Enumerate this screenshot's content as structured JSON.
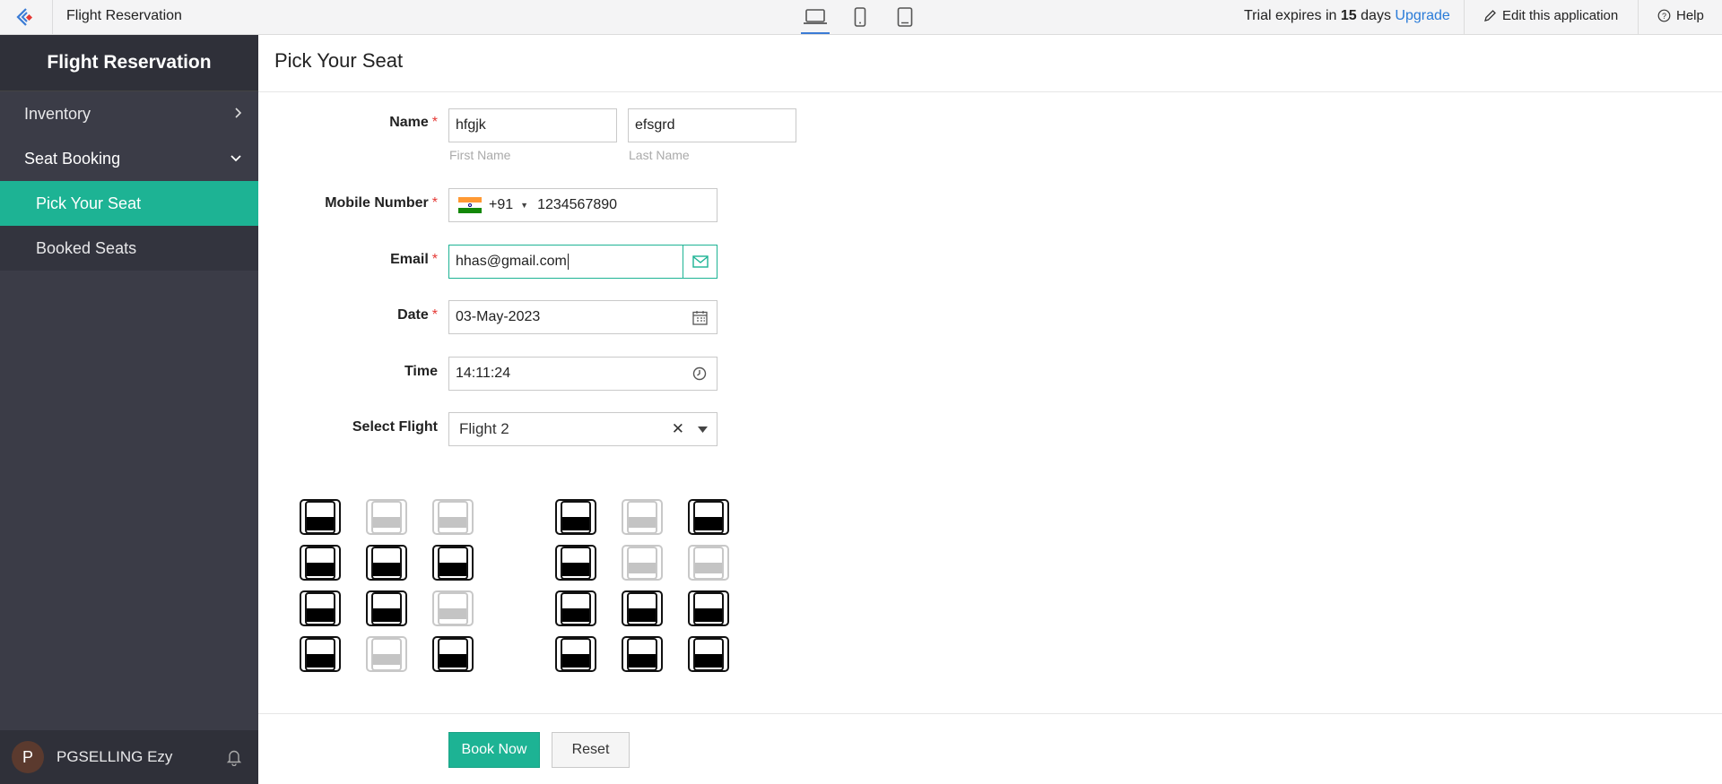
{
  "topbar": {
    "app_title": "Flight Reservation",
    "trial_prefix": "Trial expires in",
    "trial_days": "15",
    "trial_suffix": "days",
    "upgrade": "Upgrade",
    "edit": "Edit this application",
    "help": "Help",
    "devices": [
      "laptop-icon",
      "phone-icon",
      "tablet-icon"
    ],
    "active_device": "laptop-icon"
  },
  "sidebar": {
    "header": "Flight Reservation",
    "items": [
      {
        "label": "Inventory",
        "icon": "chevron-right-icon"
      },
      {
        "label": "Seat Booking",
        "icon": "chevron-down-icon"
      }
    ],
    "subitems": [
      {
        "label": "Pick Your Seat",
        "active": true
      },
      {
        "label": "Booked Seats",
        "active": false
      }
    ],
    "user": {
      "initial": "P",
      "name": "PGSELLING Ezy"
    }
  },
  "form": {
    "title": "Pick Your Seat",
    "name_label": "Name",
    "first_name": "hfgjk",
    "last_name": "efsgrd",
    "first_hint": "First Name",
    "last_hint": "Last Name",
    "mobile_label": "Mobile Number",
    "country_code": "+91",
    "mobile": "1234567890",
    "email_label": "Email",
    "email": "hhas@gmail.com",
    "date_label": "Date",
    "date": "03-May-2023",
    "time_label": "Time",
    "time": "14:11:24",
    "flight_label": "Select Flight",
    "flight": "Flight 2",
    "required_mark": "*"
  },
  "seats": {
    "left_block": [
      [
        "available",
        "unavailable",
        "unavailable"
      ],
      [
        "available",
        "available",
        "available"
      ],
      [
        "available",
        "available",
        "unavailable"
      ],
      [
        "available",
        "unavailable",
        "available"
      ]
    ],
    "right_block": [
      [
        "available",
        "unavailable",
        "available"
      ],
      [
        "available",
        "unavailable",
        "unavailable"
      ],
      [
        "available",
        "available",
        "available"
      ],
      [
        "available",
        "available",
        "available"
      ]
    ]
  },
  "actions": {
    "book": "Book Now",
    "reset": "Reset"
  },
  "colors": {
    "accent": "#1db394",
    "sidebar": "#3b3c47",
    "required": "#e53935",
    "link": "#2a7bd8"
  }
}
